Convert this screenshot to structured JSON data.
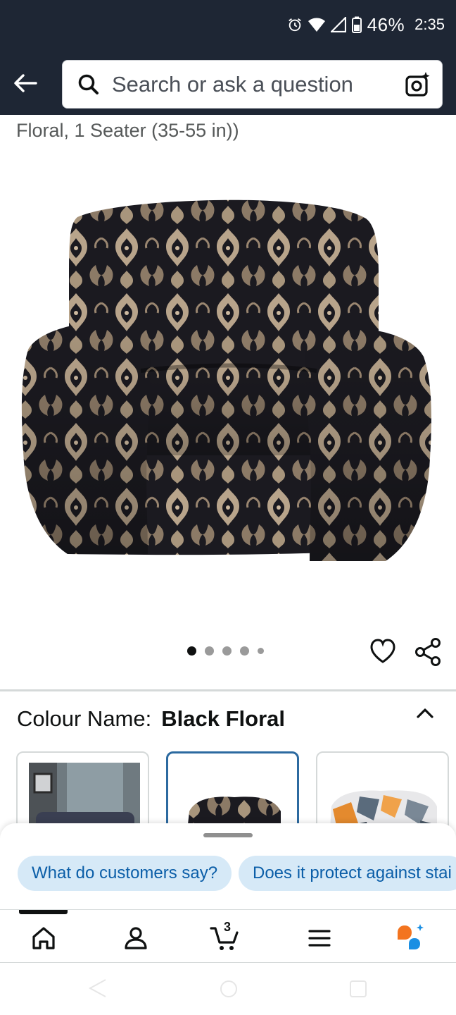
{
  "status_bar": {
    "battery": "46%",
    "time": "2:35"
  },
  "header": {
    "search_placeholder": "Search or ask a question"
  },
  "product": {
    "subtitle": "Floral, 1 Seater (35-55 in))",
    "image_count": 5,
    "active_image_index": 0
  },
  "variation": {
    "label": "Colour Name:",
    "value": "Black Floral",
    "selected_index": 1
  },
  "suggestions": {
    "chips": [
      "What do customers say?",
      "Does it protect against stai"
    ]
  },
  "bottom_nav": {
    "cart_count": "3",
    "items": [
      "home-icon",
      "account-icon",
      "cart-icon",
      "menu-icon",
      "rufus-icon"
    ]
  },
  "colors": {
    "header_bg": "#1e2634",
    "chip_bg": "#d6e9f7",
    "chip_text": "#0b5ea8",
    "selected_border": "#2c6aa0"
  }
}
